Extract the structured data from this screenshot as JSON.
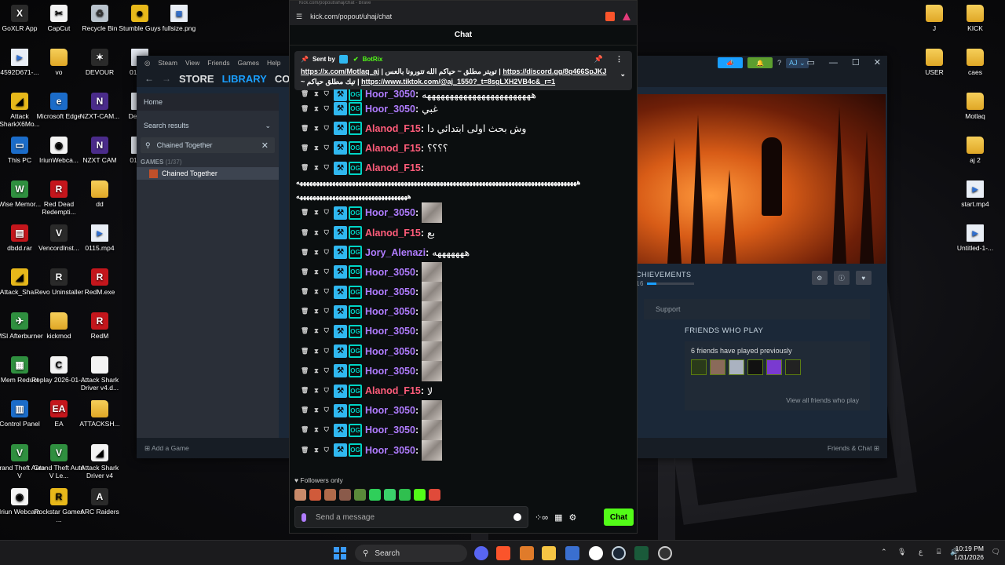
{
  "desktop": {
    "left_icons": [
      {
        "label": "GoXLR App",
        "icon": "goxlr-icon",
        "style": "app",
        "glyph": "X"
      },
      {
        "label": "CapCut",
        "icon": "capcut-icon",
        "style": "white",
        "glyph": "✂"
      },
      {
        "label": "Recycle Bin",
        "icon": "recycle-bin-icon",
        "style": "recycle",
        "glyph": "♻"
      },
      {
        "label": "Stumble Guys",
        "icon": "stumble-guys-icon",
        "style": "yellow",
        "glyph": "☻"
      },
      {
        "label": "fullsize.png",
        "icon": "image-file-icon",
        "style": "file",
        "glyph": "▣"
      },
      {
        "label": "4592D671-...",
        "icon": "video-file-icon",
        "style": "file",
        "glyph": "▶"
      },
      {
        "label": "vo",
        "icon": "folder-icon",
        "style": "folder",
        "glyph": ""
      },
      {
        "label": "DEVOUR",
        "icon": "devour-icon",
        "style": "app",
        "glyph": "✶"
      },
      {
        "label": "0130...",
        "icon": "file-icon",
        "style": "file",
        "glyph": ""
      },
      {
        "label": "Attack SharkX6Mo...",
        "icon": "attack-shark-icon",
        "style": "yellow",
        "glyph": "◢"
      },
      {
        "label": "Microsoft Edge",
        "icon": "edge-icon",
        "style": "blue",
        "glyph": "e"
      },
      {
        "label": "NZXT-CAM...",
        "icon": "nzxt-icon",
        "style": "purple",
        "glyph": "N"
      },
      {
        "label": "Deskt...",
        "icon": "file-icon",
        "style": "file",
        "glyph": ""
      },
      {
        "label": "This PC",
        "icon": "this-pc-icon",
        "style": "blue",
        "glyph": "▭"
      },
      {
        "label": "IriunWebca...",
        "icon": "iriun-icon",
        "style": "white",
        "glyph": "◉"
      },
      {
        "label": "NZXT CAM",
        "icon": "nzxt-cam-icon",
        "style": "purple",
        "glyph": "N"
      },
      {
        "label": "0115...",
        "icon": "file-icon",
        "style": "file",
        "glyph": ""
      },
      {
        "label": "Wise Memor...",
        "icon": "wise-memory-icon",
        "style": "green",
        "glyph": "W"
      },
      {
        "label": "Red Dead Redempti...",
        "icon": "red-dead-icon",
        "style": "red",
        "glyph": "R"
      },
      {
        "label": "dd",
        "icon": "folder-icon",
        "style": "folder",
        "glyph": ""
      },
      {
        "label": "dbdd.rar",
        "icon": "rar-icon",
        "style": "red",
        "glyph": "▤"
      },
      {
        "label": "VencordInst...",
        "icon": "vencord-icon",
        "style": "app",
        "glyph": "V"
      },
      {
        "label": "0115.mp4",
        "icon": "video-file-icon",
        "style": "file",
        "glyph": "▶"
      },
      {
        "label": "Attack_Sha...",
        "icon": "attack-shark-icon",
        "style": "yellow",
        "glyph": "◢"
      },
      {
        "label": "Revo Uninstaller",
        "icon": "revo-icon",
        "style": "app",
        "glyph": "R"
      },
      {
        "label": "RedM.exe",
        "icon": "redm-icon",
        "style": "red",
        "glyph": "R"
      },
      {
        "label": "MSI Afterburner",
        "icon": "msi-afterburner-icon",
        "style": "green",
        "glyph": "✈"
      },
      {
        "label": "kickmod",
        "icon": "folder-icon",
        "style": "folder",
        "glyph": ""
      },
      {
        "label": "RedM",
        "icon": "redm-icon",
        "style": "red",
        "glyph": "R"
      },
      {
        "label": "Mem Reduct",
        "icon": "mem-reduct-icon",
        "style": "green",
        "glyph": "▦"
      },
      {
        "label": "Replay 2026-01-...",
        "icon": "replay-file-icon",
        "style": "white",
        "glyph": "C"
      },
      {
        "label": "Attack Shark Driver v4.d...",
        "icon": "document-icon",
        "style": "white",
        "glyph": ""
      },
      {
        "label": "Control Panel",
        "icon": "control-panel-icon",
        "style": "blue",
        "glyph": "▥"
      },
      {
        "label": "EA",
        "icon": "ea-icon",
        "style": "red",
        "glyph": "EA"
      },
      {
        "label": "ATTACKSH...",
        "icon": "folder-icon",
        "style": "folder",
        "glyph": ""
      },
      {
        "label": "Grand Theft Auto V",
        "icon": "gta-icon",
        "style": "green",
        "glyph": "V"
      },
      {
        "label": "Grand Theft Auto V Le...",
        "icon": "gta-icon",
        "style": "green",
        "glyph": "V"
      },
      {
        "label": "Attack Shark Driver v4",
        "icon": "attack-shark-icon",
        "style": "white",
        "glyph": "◢"
      },
      {
        "label": "Iriun Webcam",
        "icon": "iriun-icon",
        "style": "white",
        "glyph": "◉"
      },
      {
        "label": "Rockstar Games ...",
        "icon": "rockstar-icon",
        "style": "yellow",
        "glyph": "R"
      },
      {
        "label": "ARC Raiders",
        "icon": "arc-raiders-icon",
        "style": "app",
        "glyph": "A"
      }
    ],
    "right_icons": [
      {
        "label": "J",
        "icon": "folder-icon",
        "style": "folder",
        "glyph": ""
      },
      {
        "label": "KICK",
        "icon": "folder-icon",
        "style": "folder",
        "glyph": ""
      },
      {
        "label": "USER",
        "icon": "folder-icon",
        "style": "folder",
        "glyph": ""
      },
      {
        "label": "caes",
        "icon": "folder-icon",
        "style": "folder",
        "glyph": ""
      },
      {
        "label": "Motlaq",
        "icon": "folder-icon",
        "style": "folder",
        "glyph": ""
      },
      {
        "label": "aj 2",
        "icon": "folder-icon",
        "style": "folder",
        "glyph": ""
      },
      {
        "label": "start.mp4",
        "icon": "video-file-icon",
        "style": "file",
        "glyph": "▶"
      },
      {
        "label": "Untitled-1-...",
        "icon": "video-file-icon",
        "style": "file",
        "glyph": "▶"
      }
    ]
  },
  "steam": {
    "menu": [
      "Steam",
      "View",
      "Friends",
      "Games",
      "Help"
    ],
    "nav": {
      "store": "STORE",
      "library": "LIBRARY",
      "community": "COM"
    },
    "home": "Home",
    "search_results": "Search results",
    "search_value": "Chained Together",
    "games_header": "GAMES",
    "games_count": "(1/37)",
    "game_name": "Chained Together",
    "add_game": "Add a Game",
    "friends_chat": "Friends & Chat",
    "user": "AJ",
    "achievements_label": "CHIEVEMENTS",
    "achievements_count": "16",
    "support": "Support",
    "friends_title": "FRIENDS WHO PLAY",
    "friends_played": "6 friends have played previously",
    "view_all": "View all friends who play",
    "colors": {
      "bg": "#1b2838",
      "accent": "#1a9fff",
      "green": "#5c7e10"
    }
  },
  "browser": {
    "tab_title": "Kick.com/popout/ahaj/chat - Brave",
    "url": "kick.com/popout/uhaj/chat",
    "chat_title": "Chat",
    "pinned": {
      "sent_by": "Sent by",
      "sender": "BotRix",
      "line1_link": "https://x.com/Motlaq_aj",
      "line1_text": " | تويتر مطلق ~ حياكم الله تتورونا بالعس | ",
      "line1_link2": "https://discord.gg/8q466SpJKJ",
      "line2_text": "~ تيك مطلق حياكم | ",
      "line2_link": "https://www.tiktok.com/@aj_1550?_t=8sgLXH2VB4c&_r=1"
    },
    "messages": [
      {
        "user": "Hoor_3050",
        "color": "#b07cff",
        "text": "ههههههههههههههههههههههههه",
        "image": false
      },
      {
        "user": "Hoor_3050",
        "color": "#b07cff",
        "text": "غبي",
        "image": false
      },
      {
        "user": "Alanod_F15",
        "color": "#ff5c7a",
        "text": "وش بحث اولى ابتدائي دا",
        "image": false
      },
      {
        "user": "Alanod_F15",
        "color": "#ff5c7a",
        "text": "؟؟؟؟",
        "image": false
      },
      {
        "user": "Alanod_F15",
        "color": "#ff5c7a",
        "text": "",
        "image": false
      },
      {
        "user": "Hoor_3050",
        "color": "#b07cff",
        "text": "",
        "image": true
      },
      {
        "user": "Alanod_F15",
        "color": "#ff5c7a",
        "text": "بع",
        "image": false
      },
      {
        "user": "Jory_Alenazi",
        "color": "#b07cff",
        "text": "هههههههه",
        "image": false
      },
      {
        "user": "Hoor_3050",
        "color": "#b07cff",
        "text": "",
        "image": true
      },
      {
        "user": "Hoor_3050",
        "color": "#b07cff",
        "text": "",
        "image": true
      },
      {
        "user": "Hoor_3050",
        "color": "#b07cff",
        "text": "",
        "image": true
      },
      {
        "user": "Hoor_3050",
        "color": "#b07cff",
        "text": "",
        "image": true
      },
      {
        "user": "Hoor_3050",
        "color": "#b07cff",
        "text": "",
        "image": true
      },
      {
        "user": "Hoor_3050",
        "color": "#b07cff",
        "text": "",
        "image": true
      },
      {
        "user": "Alanod_F15",
        "color": "#ff5c7a",
        "text": "لا",
        "image": false
      },
      {
        "user": "Hoor_3050",
        "color": "#b07cff",
        "text": "",
        "image": true
      },
      {
        "user": "Hoor_3050",
        "color": "#b07cff",
        "text": "",
        "image": true
      },
      {
        "user": "Hoor_3050",
        "color": "#b07cff",
        "text": "",
        "image": true
      }
    ],
    "long_laugh": "ههههههههههههههههههههههههههههههههههههههههههههههههههههههههههههههههههههههههههههههههههههههه",
    "long_laugh2": "ههههههههههههههههههههههههههههههههههه",
    "followers_only": "Followers only",
    "input_placeholder": "Send a message",
    "chat_button": "Chat"
  },
  "taskbar": {
    "search": "Search",
    "time": "10:19 PM",
    "date": "1/31/2026",
    "lang": "ع"
  }
}
